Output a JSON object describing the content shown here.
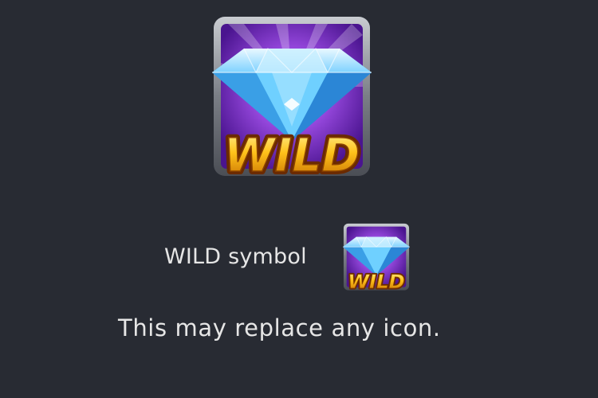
{
  "symbol": {
    "name": "WILD",
    "icon": "diamond-icon"
  },
  "paytable": {
    "symbol_label": "WILD symbol",
    "description": "This may replace any icon."
  },
  "colors": {
    "background": "#282b33",
    "frame": "#8e9299",
    "tile_purple": "#7b2fd0",
    "diamond_blue": "#5fc3ff",
    "wild_gold": "#f7b900",
    "text": "#e6e6e6"
  }
}
